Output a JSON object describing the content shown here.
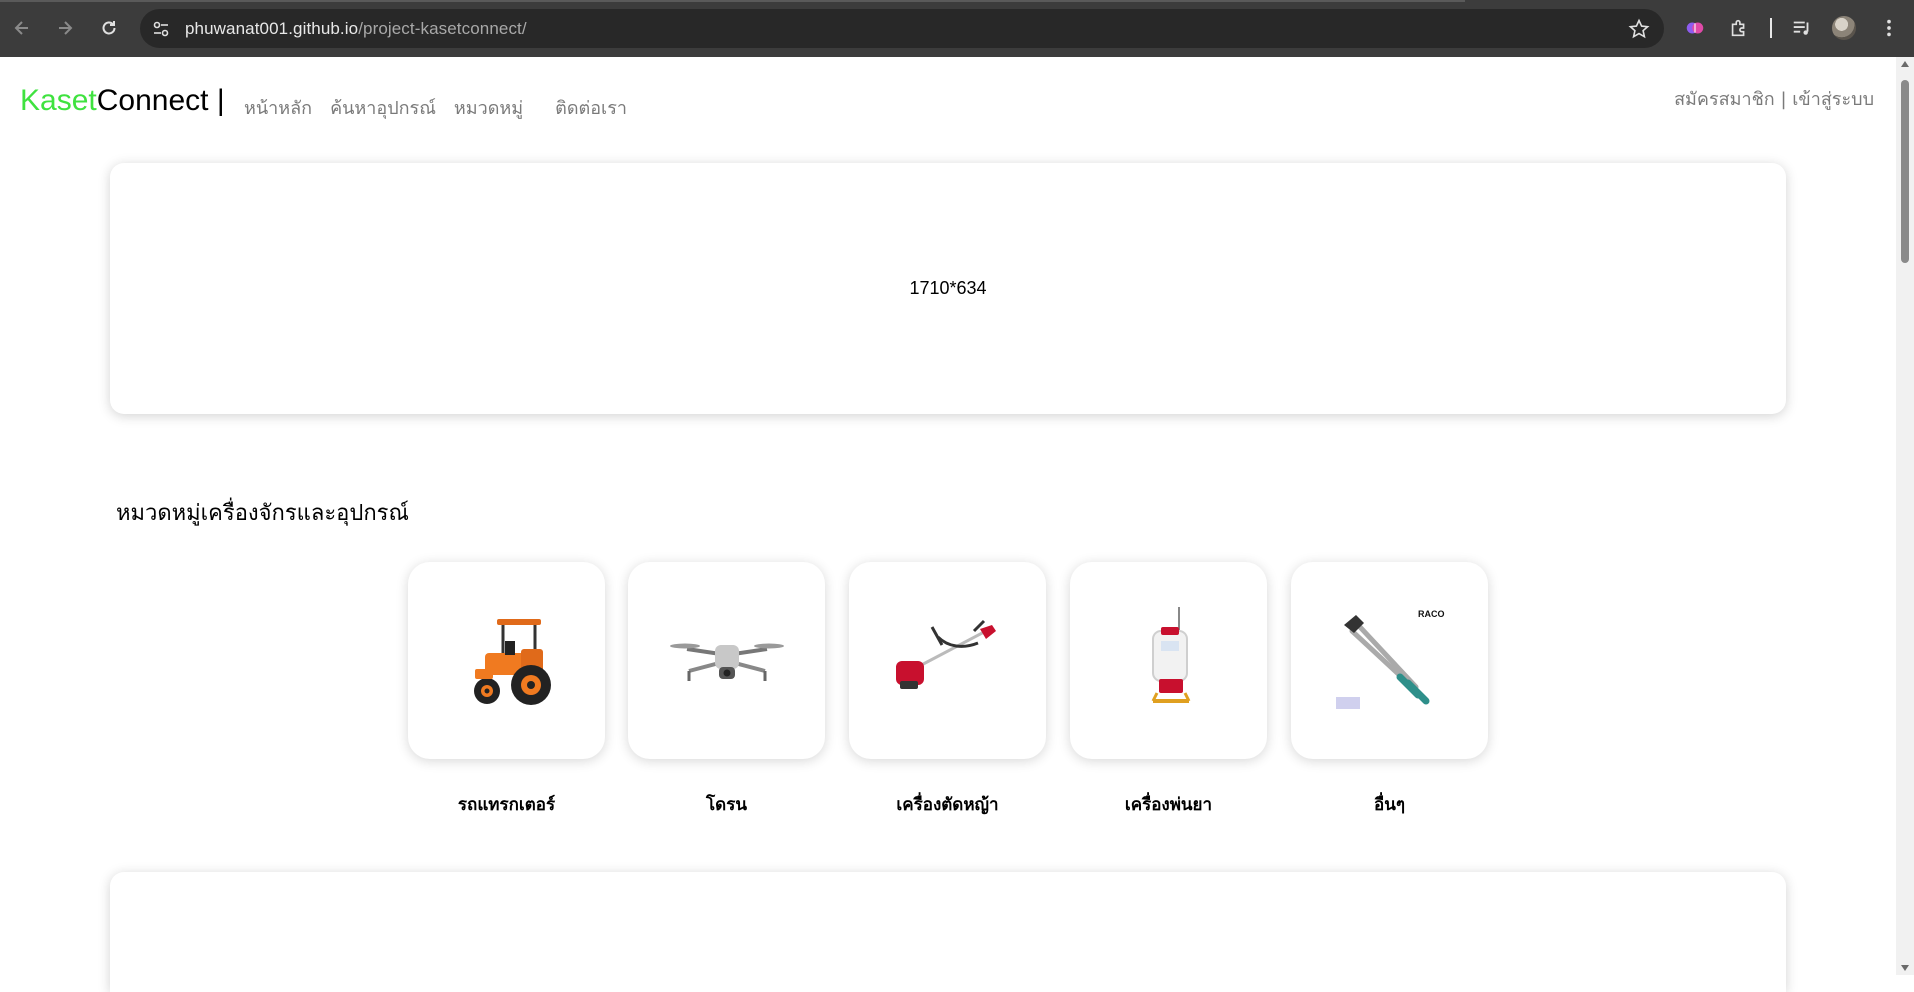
{
  "browser": {
    "url_host": "phuwanat001.github.io",
    "url_path": "/project-kasetconnect/"
  },
  "site": {
    "brand_green": "Kaset",
    "brand_black": "Connect",
    "brand_sep": "|",
    "brand_color": "#3fe23f",
    "nav": {
      "home": "หน้าหลัก",
      "search": "ค้นหาอุปกรณ์",
      "categories": "หมวดหมู่",
      "contact": "ติดต่อเรา"
    },
    "auth": {
      "register": "สมัครสมาชิก",
      "sep": "|",
      "login": "เข้าสู่ระบบ"
    }
  },
  "hero": {
    "placeholder_text": "1710*634"
  },
  "categories": {
    "title": "หมวดหมู่เครื่องจักรและอุปกรณ์",
    "items": [
      {
        "label": "รถแทรกเตอร์",
        "icon": "tractor-icon"
      },
      {
        "label": "โดรน",
        "icon": "drone-icon"
      },
      {
        "label": "เครื่องตัดหญ้า",
        "icon": "grass-trimmer-icon"
      },
      {
        "label": "เครื่องพ่นยา",
        "icon": "sprayer-icon"
      },
      {
        "label": "อื่นๆ",
        "icon": "pruning-shears-icon"
      }
    ]
  }
}
